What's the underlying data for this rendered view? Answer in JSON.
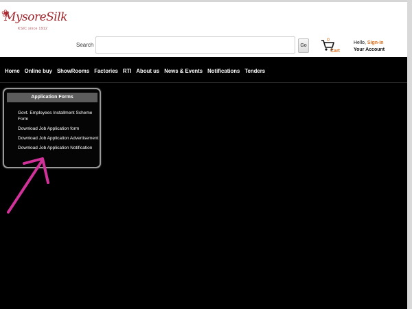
{
  "header": {
    "logo_text": "MysoreSilk",
    "logo_sub": "KSIC since 1912",
    "search_label": "Search",
    "search_placeholder": "",
    "go_label": "Go",
    "cart_count": "0",
    "cart_label": "Cart",
    "account_hello": "Hello, ",
    "account_signin": "Sign-in",
    "account_your": "Your Account"
  },
  "nav": {
    "items": [
      "Home",
      "Online buy",
      "ShowRooms",
      "Factories",
      "RTI",
      "About us",
      "News & Events",
      "Notifications",
      "Tenders"
    ]
  },
  "panel": {
    "title": "Application Forms",
    "links": [
      "Govt. Employees Installment Scheme Form",
      "Download Job Application form",
      "Download Job Application Advertisement",
      "Download Job Application Notification"
    ]
  },
  "colors": {
    "accent": "#e07020",
    "annotation_arrow": "#d1329a",
    "background": "#000000"
  }
}
